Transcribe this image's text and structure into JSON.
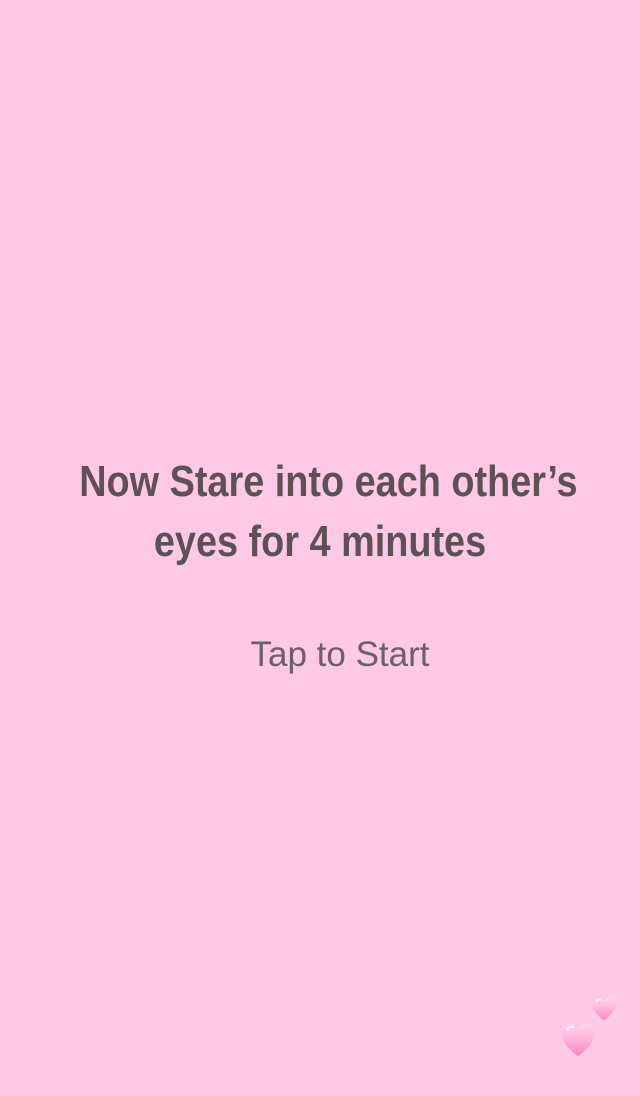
{
  "screen": {
    "background_color": "#fdc9e4",
    "instruction_lines": [
      "Now Stare into each other’s",
      "eyes for 4 minutes"
    ],
    "start_label": "Tap to Start",
    "decorations": [
      "pink-heart-icon",
      "pink-heart-icon"
    ]
  },
  "colors": {
    "heading_text": "#5d5156",
    "button_text": "#6c5f65",
    "heart_fill": "#fca3d0"
  }
}
